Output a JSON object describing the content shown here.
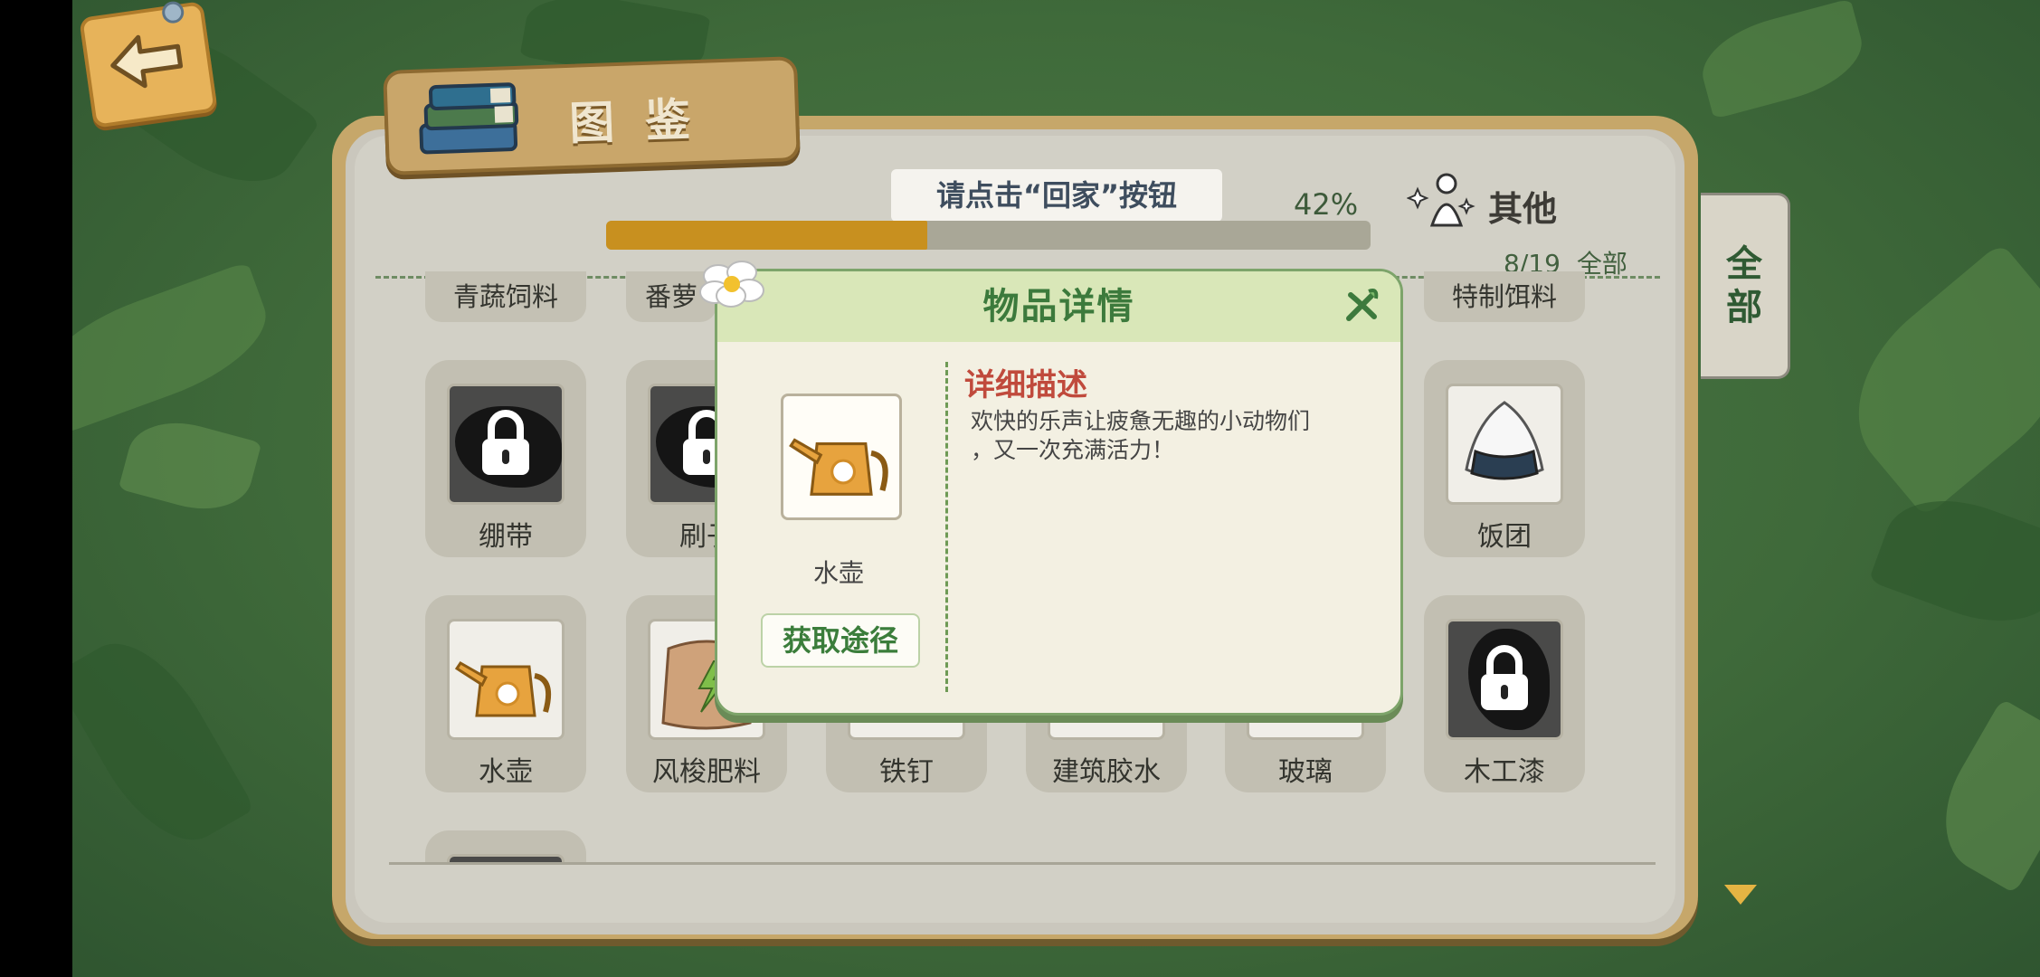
{
  "back_button": {
    "icon": "back-arrow-icon"
  },
  "header": {
    "title": "图鉴"
  },
  "progress": {
    "tip": "请点击“回家”按钮",
    "percent_label": "42%",
    "fraction": 0.42
  },
  "category": {
    "name": "其他",
    "count": "8/19",
    "filter": "全部"
  },
  "side_tab": {
    "label": "全部"
  },
  "top_row": [
    "青蔬饲料",
    "番萝",
    "特制饵料"
  ],
  "grid": [
    {
      "name": "绷带",
      "locked": true
    },
    {
      "name": "刷子",
      "locked": true
    },
    {
      "name": "饭团",
      "locked": false
    },
    {
      "name": "水壶",
      "locked": false
    },
    {
      "name": "风梭肥料",
      "locked": false
    },
    {
      "name": "铁钉",
      "locked": false
    },
    {
      "name": "建筑胶水",
      "locked": false
    },
    {
      "name": "玻璃",
      "locked": false
    },
    {
      "name": "木工漆",
      "locked": true
    }
  ],
  "modal": {
    "title": "物品详情",
    "item_name": "水壶",
    "acquire_label": "获取途径",
    "desc_title": "详细描述",
    "desc_line1": "欢快的乐声让疲惫无趣的小动物们",
    "desc_line2": "，又一次充满活力！"
  },
  "colors": {
    "accent": "#3c7a3c",
    "progress": "#c8901f",
    "desc_title": "#c04a3c"
  }
}
